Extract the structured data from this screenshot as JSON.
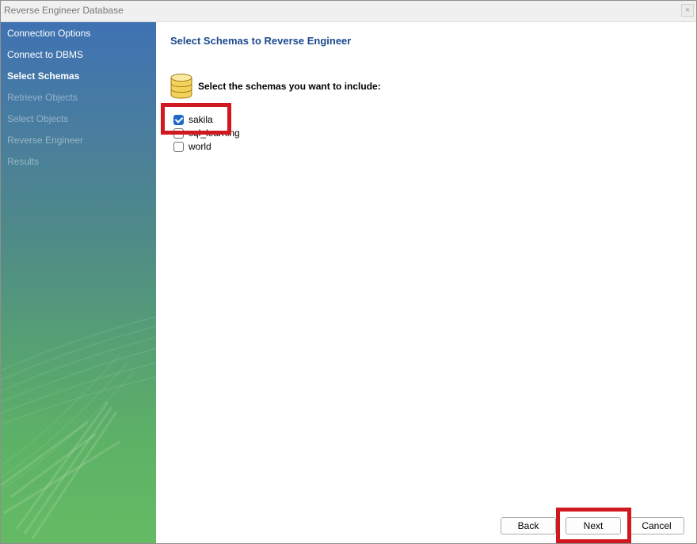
{
  "window": {
    "title": "Reverse Engineer Database",
    "close_glyph": "×"
  },
  "sidebar": {
    "items": [
      {
        "label": "Connection Options",
        "state": "done"
      },
      {
        "label": "Connect to DBMS",
        "state": "done"
      },
      {
        "label": "Select Schemas",
        "state": "current"
      },
      {
        "label": "Retrieve Objects",
        "state": "pending"
      },
      {
        "label": "Select Objects",
        "state": "pending"
      },
      {
        "label": "Reverse Engineer",
        "state": "pending"
      },
      {
        "label": "Results",
        "state": "pending"
      }
    ]
  },
  "main": {
    "heading": "Select Schemas to Reverse Engineer",
    "instruction": "Select the schemas you want to include:",
    "icon": "database-icon",
    "schemas": [
      {
        "name": "sakila",
        "checked": true
      },
      {
        "name": "sql_learning",
        "checked": false
      },
      {
        "name": "world",
        "checked": false
      }
    ]
  },
  "buttons": {
    "back": "Back",
    "next": "Next",
    "cancel": "Cancel"
  },
  "colors": {
    "highlight": "#d0181f",
    "heading": "#1c4a8e",
    "checkbox_checked": "#1d68c6"
  }
}
